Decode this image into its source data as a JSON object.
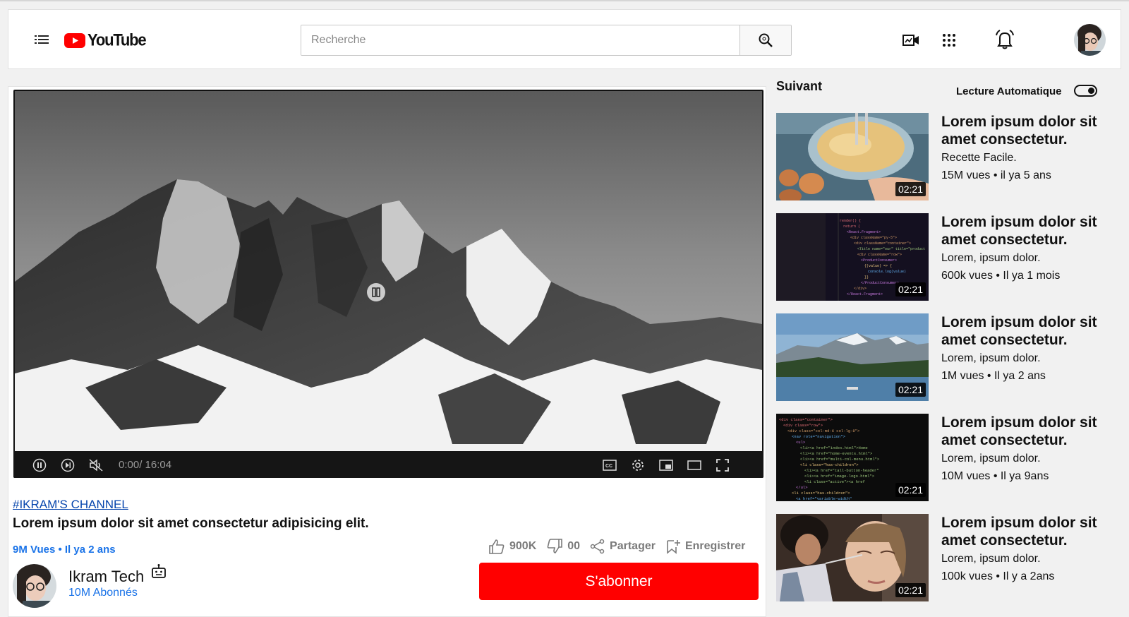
{
  "header": {
    "logo_text": "YouTube",
    "search_placeholder": "Recherche"
  },
  "player": {
    "time": "0:00/ 16:04"
  },
  "video": {
    "channel_tag": "#IKRAM'S CHANNEL",
    "title": "Lorem ipsum dolor sit amet consectetur adipisicing elit.",
    "stats": "9M Vues • Il ya 2 ans",
    "likes": "900K",
    "dislikes": "00",
    "share_label": "Partager",
    "save_label": "Enregistrer"
  },
  "channel": {
    "name": "Ikram Tech",
    "subscribers": "10M Abonnés",
    "subscribe_label": "S'abonner"
  },
  "sidebar": {
    "next_label": "Suivant",
    "autoplay_label": "Lecture Automatique",
    "autoplay_on": true,
    "videos": [
      {
        "title": "Lorem ipsum dolor sit amet consectetur.",
        "subtitle": "Recette Facile.",
        "meta": "15M vues • il ya 5 ans",
        "duration": "02:21",
        "thumb": "baking"
      },
      {
        "title": "Lorem ipsum dolor sit amet consectetur.",
        "subtitle": "Lorem, ipsum dolor.",
        "meta": "600k vues • Il ya 1 mois",
        "duration": "02:21",
        "thumb": "code-dark"
      },
      {
        "title": "Lorem ipsum dolor sit amet consectetur.",
        "subtitle": "Lorem, ipsum dolor.",
        "meta": "1M vues • Il ya 2 ans",
        "duration": "02:21",
        "thumb": "lake-mountains"
      },
      {
        "title": "Lorem ipsum dolor sit amet consectetur.",
        "subtitle": "Lorem, ipsum dolor.",
        "meta": "10M vues • Il ya 9ans",
        "duration": "02:21",
        "thumb": "code-html"
      },
      {
        "title": "Lorem ipsum dolor sit amet consectetur.",
        "subtitle": "Lorem, ipsum dolor.",
        "meta": "100k vues • Il y a 2ans",
        "duration": "02:21",
        "thumb": "makeup"
      }
    ]
  },
  "colors": {
    "brand_red": "#ff0000",
    "link_blue": "#1a73e8"
  }
}
